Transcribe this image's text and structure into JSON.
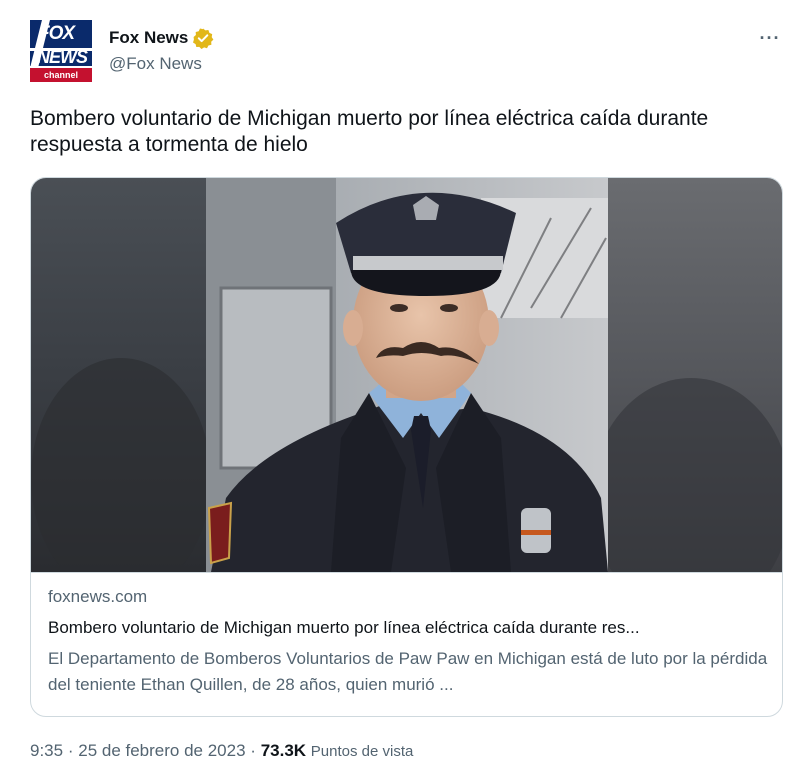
{
  "account": {
    "display_name": "Fox News",
    "handle": "@Fox News",
    "avatar": {
      "line1": "FOX",
      "line2": "NEWS",
      "line3": "channel",
      "colors": {
        "navy": "#0a2a6b",
        "red": "#c4112f"
      }
    },
    "verified_badge_color": "#e2b719"
  },
  "more_icon": "···",
  "tweet": {
    "text": "Bombero voluntario de Michigan muerto por línea eléctrica caída durante respuesta a tormenta de hielo"
  },
  "card": {
    "image_alt_icon": "firefighter-portrait-image",
    "domain": "foxnews.com",
    "title": "Bombero voluntario de Michigan muerto por línea eléctrica caída durante res...",
    "description": "El Departamento de Bomberos Voluntarios de Paw Paw en Michigan está de luto por la pérdida del teniente Ethan Quillen, de 28 años, quien murió ..."
  },
  "meta": {
    "time": "9:35",
    "separator": "·",
    "date": "25 de febrero de 2023",
    "views_count": "73.3K",
    "views_label": "Puntos de vista"
  },
  "colors": {
    "text_primary": "#0f1419",
    "text_secondary": "#536471",
    "border": "#cfd9de"
  }
}
